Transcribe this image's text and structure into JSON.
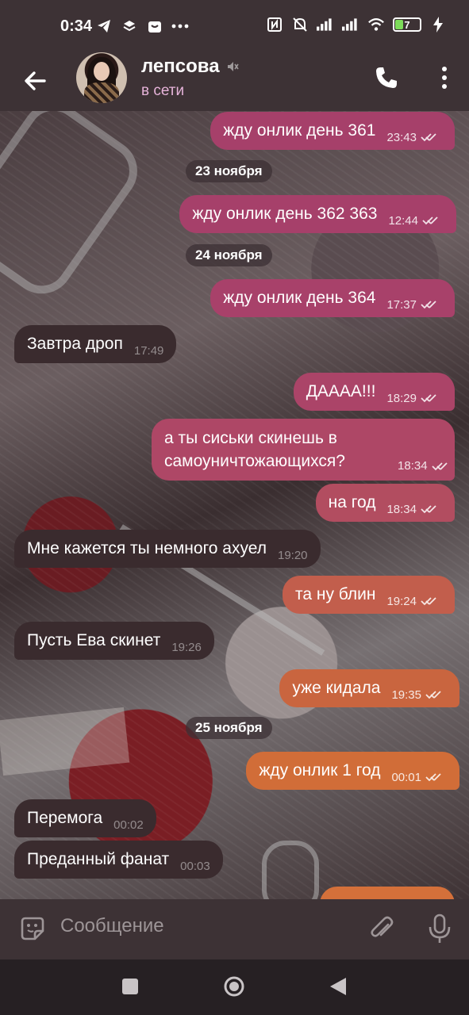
{
  "status_bar": {
    "time": "0:34",
    "battery": "7"
  },
  "header": {
    "contact_name": "лепсова",
    "status": "в сети"
  },
  "messages": [
    {
      "text": "жду онлик день 361",
      "time": "23:43"
    },
    {
      "date": "23 ноября"
    },
    {
      "text": "жду онлик день 362 363",
      "time": "12:44"
    },
    {
      "date": "24 ноября"
    },
    {
      "text": "жду онлик день 364",
      "time": "17:37"
    },
    {
      "text": "Завтра дроп",
      "time": "17:49"
    },
    {
      "text": "ДАААА!!!",
      "time": "18:29"
    },
    {
      "text": "а ты сиськи скинешь в самоуничтожающихся?",
      "time": "18:34"
    },
    {
      "text": "на год",
      "time": "18:34"
    },
    {
      "text": "Мне кажется ты немного ахуел",
      "time": "19:20"
    },
    {
      "text": "та ну блин",
      "time": "19:24"
    },
    {
      "text": "Пусть Ева скинет",
      "time": "19:26"
    },
    {
      "text": "уже кидала",
      "time": "19:35"
    },
    {
      "date": "25 ноября"
    },
    {
      "text": "жду онлик 1 год",
      "time": "00:01"
    },
    {
      "text": "Перемога",
      "time": "00:02"
    },
    {
      "text": "Преданный фанат",
      "time": "00:03"
    }
  ],
  "input": {
    "placeholder": "Сообщение"
  },
  "colors": {
    "outgoing_top": "#a6416a",
    "outgoing_bottom": "#d4703a",
    "incoming": "#3a2b2e",
    "status_online": "#e6b3d9"
  }
}
